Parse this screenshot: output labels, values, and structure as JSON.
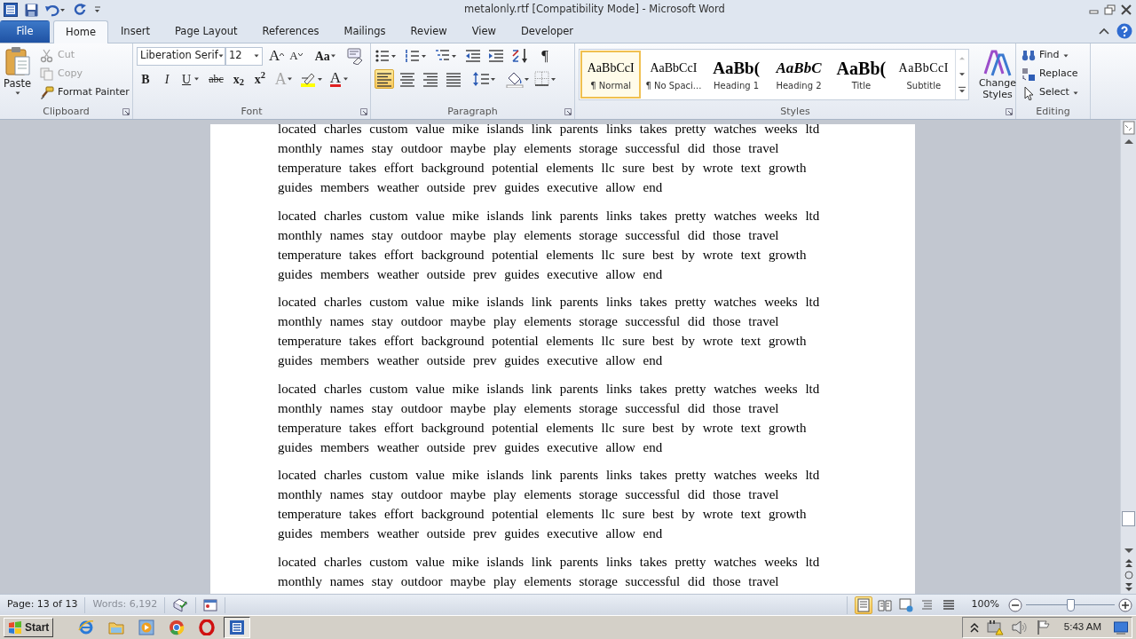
{
  "window": {
    "title": "metalonly.rtf [Compatibility Mode] - Microsoft Word"
  },
  "tabs": [
    {
      "label": "File",
      "kind": "file",
      "selected": false
    },
    {
      "label": "Home",
      "kind": "tab",
      "selected": true
    },
    {
      "label": "Insert",
      "kind": "tab",
      "selected": false
    },
    {
      "label": "Page Layout",
      "kind": "tab",
      "selected": false
    },
    {
      "label": "References",
      "kind": "tab",
      "selected": false
    },
    {
      "label": "Mailings",
      "kind": "tab",
      "selected": false
    },
    {
      "label": "Review",
      "kind": "tab",
      "selected": false
    },
    {
      "label": "View",
      "kind": "tab",
      "selected": false
    },
    {
      "label": "Developer",
      "kind": "tab",
      "selected": false
    }
  ],
  "clipboard": {
    "label": "Clipboard",
    "paste": "Paste",
    "commands": [
      {
        "kind": "cut",
        "label": "Cut",
        "disabled": true
      },
      {
        "kind": "copy",
        "label": "Copy",
        "disabled": true
      },
      {
        "kind": "painter",
        "label": "Format Painter",
        "disabled": false
      }
    ]
  },
  "font": {
    "label": "Font",
    "font_name": "Liberation Serif",
    "font_size": "12",
    "top_buttons": [
      {
        "kind": "grow",
        "label": "A"
      },
      {
        "kind": "shrink",
        "label": "A"
      },
      {
        "kind": "case",
        "label": "Aa"
      }
    ],
    "bottom_buttons": [
      {
        "kind": "bold",
        "label": "B",
        "disabled": false
      },
      {
        "kind": "italic",
        "label": "I",
        "disabled": false
      },
      {
        "kind": "underline",
        "label": "U",
        "disabled": false
      },
      {
        "kind": "strike",
        "label": "abc",
        "disabled": false
      },
      {
        "kind": "sub",
        "label": "x$_{2}$",
        "disabled": false
      },
      {
        "kind": "sup",
        "label": "x$^{2}$",
        "disabled": false
      },
      {
        "kind": "effects",
        "label": "A",
        "disabled": true
      },
      {
        "kind": "color",
        "label": "A",
        "disabled": false
      }
    ]
  },
  "paragraph": {
    "label": "Paragraph",
    "show_marks": "¶",
    "alignments": [
      {
        "kind": "left",
        "selected": true
      },
      {
        "kind": "center",
        "selected": false
      },
      {
        "kind": "right",
        "selected": false
      },
      {
        "kind": "justify",
        "selected": false
      }
    ]
  },
  "styles": {
    "label": "Styles",
    "change_styles": "Change Styles",
    "items": [
      {
        "kind": "normal",
        "preview": "AaBbCcI",
        "label": "¶ Normal",
        "selected": true
      },
      {
        "kind": "nospacing",
        "preview": "AaBbCcI",
        "label": "¶ No Spaci...",
        "selected": false
      },
      {
        "kind": "heading1",
        "preview": "AaBb(",
        "label": "Heading 1",
        "selected": false
      },
      {
        "kind": "heading2",
        "preview": "AaBbC",
        "label": "Heading 2",
        "selected": false
      },
      {
        "kind": "title",
        "preview": "AaBb(",
        "label": "Title",
        "selected": false
      },
      {
        "kind": "subtitle",
        "preview": "AaBbCcI",
        "label": "Subtitle",
        "selected": false
      }
    ]
  },
  "editing": {
    "label": "Editing",
    "commands": [
      {
        "kind": "find",
        "label": "Find"
      },
      {
        "kind": "replace",
        "label": "Replace"
      },
      {
        "kind": "select",
        "label": "Select"
      }
    ]
  },
  "document": {
    "paragraphs": [
      {
        "lines": [
          "located charles custom value mike islands link parents links takes pretty watches weeks ltd",
          "monthly names stay outdoor maybe play elements storage successful did those travel",
          "temperature takes effort background potential elements llc sure best by wrote text growth",
          "guides members weather outside prev guides executive allow end"
        ]
      },
      {
        "lines": [
          "located charles custom value mike islands link parents links takes pretty watches weeks ltd",
          "monthly names stay outdoor maybe play elements storage successful did those travel",
          "temperature takes effort background potential elements llc sure best by wrote text growth",
          "guides members weather outside prev guides executive allow end"
        ]
      },
      {
        "lines": [
          "located charles custom value mike islands link parents links takes pretty watches weeks ltd",
          "monthly names stay outdoor maybe play elements storage successful did those travel",
          "temperature takes effort background potential elements llc sure best by wrote text growth",
          "guides members weather outside prev guides executive allow end"
        ]
      },
      {
        "lines": [
          "located charles custom value mike islands link parents links takes pretty watches weeks ltd",
          "monthly names stay outdoor maybe play elements storage successful did those travel",
          "temperature takes effort background potential elements llc sure best by wrote text growth",
          "guides members weather outside prev guides executive allow end"
        ]
      },
      {
        "lines": [
          "located charles custom value mike islands link parents links takes pretty watches weeks ltd",
          "monthly names stay outdoor maybe play elements storage successful did those travel",
          "temperature takes effort background potential elements llc sure best by wrote text growth",
          "guides members weather outside prev guides executive allow end"
        ]
      },
      {
        "lines": [
          "located charles custom value mike islands link parents links takes pretty watches weeks ltd",
          "monthly names stay outdoor maybe play elements storage successful did those travel"
        ]
      }
    ]
  },
  "status_bar": {
    "page": "Page: 13 of 13",
    "words": "Words: 6,192",
    "views": [
      {
        "kind": "print",
        "selected": true
      },
      {
        "kind": "reading",
        "selected": false
      },
      {
        "kind": "web",
        "selected": false
      },
      {
        "kind": "outline",
        "selected": false
      },
      {
        "kind": "draft",
        "selected": false
      }
    ],
    "zoom": {
      "label": "100%",
      "level": 0.5
    }
  },
  "taskbar": {
    "start": "Start",
    "apps": [
      {
        "kind": "ie",
        "selected": false
      },
      {
        "kind": "folder",
        "selected": false
      },
      {
        "kind": "media",
        "selected": false
      },
      {
        "kind": "chrome",
        "selected": false
      },
      {
        "kind": "opera",
        "selected": false
      },
      {
        "kind": "word",
        "selected": true
      }
    ],
    "clock": "5:43 AM"
  }
}
